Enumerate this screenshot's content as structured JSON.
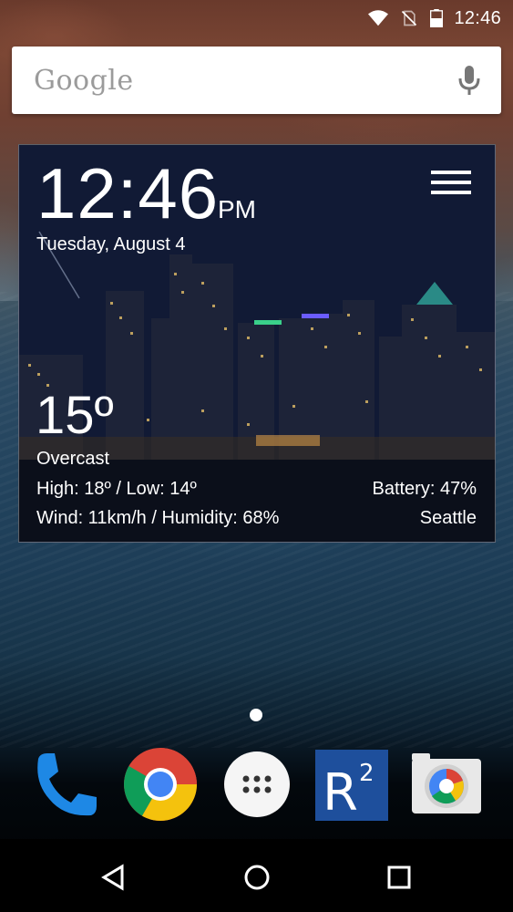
{
  "status_bar": {
    "time": "12:46",
    "icons": [
      "wifi-icon",
      "no-sim-icon",
      "battery-icon"
    ]
  },
  "search_bar": {
    "logo_text": "Google",
    "mic_icon": "mic-icon"
  },
  "weather_widget": {
    "time": "12:46",
    "ampm": "PM",
    "date": "Tuesday, August 4",
    "menu_icon": "hamburger-menu-icon",
    "temperature": "15º",
    "condition": "Overcast",
    "high_low": "High: 18º / Low: 14º",
    "battery": "Battery: 47%",
    "wind_humidity": "Wind: 11km/h / Humidity: 68%",
    "location": "Seattle"
  },
  "home": {
    "page_indicator": {
      "pages": 1,
      "current": 1
    }
  },
  "dock": {
    "apps": [
      {
        "name": "Phone",
        "icon": "phone-icon"
      },
      {
        "name": "Chrome",
        "icon": "chrome-icon"
      },
      {
        "name": "App drawer",
        "icon": "app-drawer-icon"
      },
      {
        "name": "R2",
        "icon": "r2-app-icon",
        "label": "R2"
      },
      {
        "name": "Camera",
        "icon": "camera-icon"
      }
    ]
  },
  "nav_bar": {
    "buttons": [
      "back-icon",
      "home-icon",
      "recents-icon"
    ]
  },
  "colors": {
    "phone_blue": "#1e88e5",
    "r2_blue": "#1e4f9c",
    "chrome_red": "#db4437",
    "chrome_yellow": "#f4c20d",
    "chrome_green": "#0f9d58",
    "chrome_blue": "#4285f4"
  }
}
